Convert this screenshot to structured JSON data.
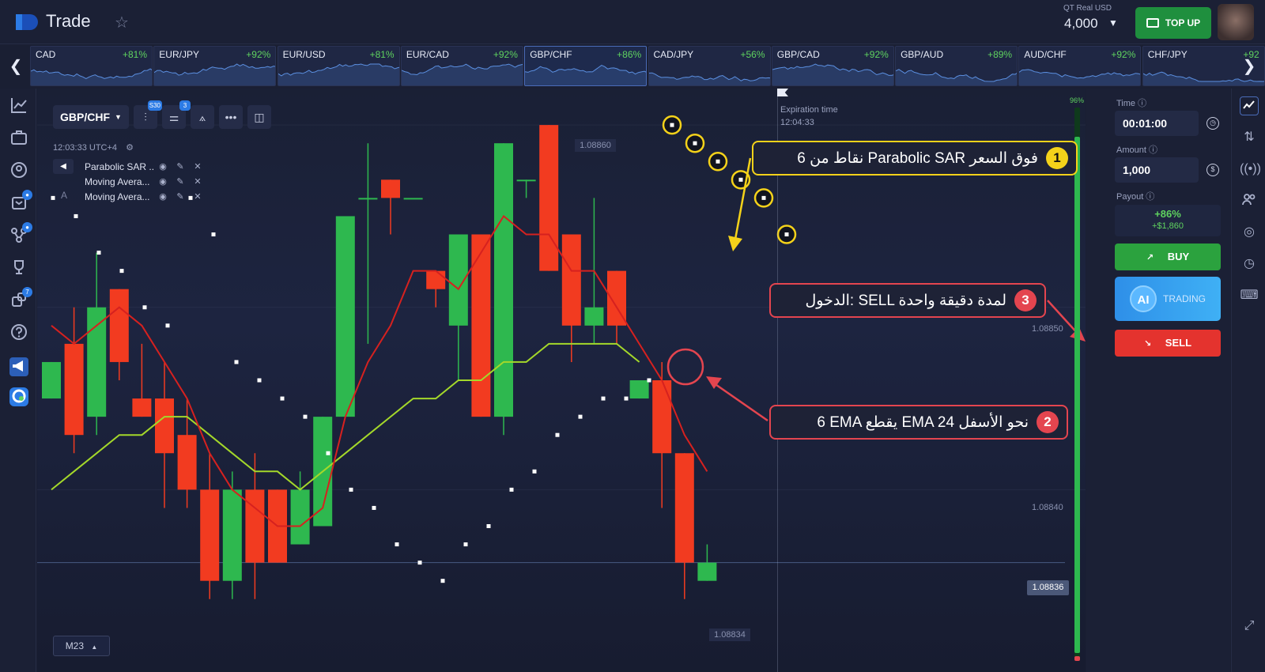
{
  "app": {
    "name": "Trade"
  },
  "account": {
    "label": "QT Real  USD",
    "balance": "4,000",
    "topup_label": "TOP UP"
  },
  "pairs": [
    {
      "name": "CAD",
      "payout": "+81%"
    },
    {
      "name": "EUR/JPY",
      "payout": "+92%"
    },
    {
      "name": "EUR/USD",
      "payout": "+81%"
    },
    {
      "name": "EUR/CAD",
      "payout": "+92%"
    },
    {
      "name": "GBP/CHF",
      "payout": "+86%"
    },
    {
      "name": "CAD/JPY",
      "payout": "+56%"
    },
    {
      "name": "GBP/CAD",
      "payout": "+92%"
    },
    {
      "name": "GBP/AUD",
      "payout": "+89%"
    },
    {
      "name": "AUD/CHF",
      "payout": "+92%"
    },
    {
      "name": "CHF/JPY",
      "payout": "+92"
    }
  ],
  "active_pair_index": 4,
  "chart": {
    "symbol": "GBP/CHF",
    "clock": "12:03:33 UTC+4",
    "tool_badges": [
      "S30",
      "3"
    ],
    "indicators": [
      "Parabolic SAR ...",
      "Moving Avera...",
      "Moving Avera..."
    ],
    "expiration_label": "Expiration time",
    "expiration_time": "12:04:33",
    "price_high": "1.08860",
    "price_low": "1.08834",
    "current_price": "1.08836",
    "price_levels": [
      "1.08850",
      "1.08840"
    ],
    "timeframe": "M23",
    "volume_pct": "96%",
    "volume_level": 0.96
  },
  "chart_data": {
    "type": "candlestick",
    "candles": [
      {
        "o": 1.08845,
        "h": 1.08847,
        "l": 1.08845,
        "c": 1.08847
      },
      {
        "o": 1.08848,
        "h": 1.0885,
        "l": 1.08842,
        "c": 1.08843
      },
      {
        "o": 1.08844,
        "h": 1.08853,
        "l": 1.08843,
        "c": 1.0885
      },
      {
        "o": 1.08851,
        "h": 1.08851,
        "l": 1.08846,
        "c": 1.08847
      },
      {
        "o": 1.08845,
        "h": 1.08848,
        "l": 1.08844,
        "c": 1.08844
      },
      {
        "o": 1.08845,
        "h": 1.08847,
        "l": 1.08839,
        "c": 1.08842
      },
      {
        "o": 1.08843,
        "h": 1.08845,
        "l": 1.08839,
        "c": 1.0884
      },
      {
        "o": 1.0884,
        "h": 1.08842,
        "l": 1.08834,
        "c": 1.08835
      },
      {
        "o": 1.08835,
        "h": 1.08841,
        "l": 1.08834,
        "c": 1.0884
      },
      {
        "o": 1.0884,
        "h": 1.08842,
        "l": 1.08834,
        "c": 1.08836
      },
      {
        "o": 1.0884,
        "h": 1.0884,
        "l": 1.08836,
        "c": 1.08836
      },
      {
        "o": 1.08837,
        "h": 1.08841,
        "l": 1.08837,
        "c": 1.0884
      },
      {
        "o": 1.08838,
        "h": 1.08844,
        "l": 1.08838,
        "c": 1.08844
      },
      {
        "o": 1.08844,
        "h": 1.08855,
        "l": 1.08844,
        "c": 1.08855
      },
      {
        "o": 1.08856,
        "h": 1.08859,
        "l": 1.08848,
        "c": 1.08856
      },
      {
        "o": 1.08857,
        "h": 1.08856,
        "l": 1.08854,
        "c": 1.08856
      },
      {
        "o": 1.08856,
        "h": 1.08856,
        "l": 1.08856,
        "c": 1.08856
      },
      {
        "o": 1.08852,
        "h": 1.08852,
        "l": 1.0885,
        "c": 1.08851
      },
      {
        "o": 1.08849,
        "h": 1.08854,
        "l": 1.08846,
        "c": 1.08854
      },
      {
        "o": 1.08854,
        "h": 1.08854,
        "l": 1.08844,
        "c": 1.08844
      },
      {
        "o": 1.08844,
        "h": 1.08859,
        "l": 1.08843,
        "c": 1.08859
      },
      {
        "o": 1.08857,
        "h": 1.08857,
        "l": 1.08856,
        "c": 1.08857
      },
      {
        "o": 1.0886,
        "h": 1.0886,
        "l": 1.08852,
        "c": 1.08852
      },
      {
        "o": 1.08854,
        "h": 1.08854,
        "l": 1.08847,
        "c": 1.08849
      },
      {
        "o": 1.08849,
        "h": 1.08856,
        "l": 1.08848,
        "c": 1.0885
      },
      {
        "o": 1.08852,
        "h": 1.08852,
        "l": 1.08848,
        "c": 1.08849
      },
      {
        "o": 1.08845,
        "h": 1.08846,
        "l": 1.08845,
        "c": 1.08846
      },
      {
        "o": 1.08846,
        "h": 1.08847,
        "l": 1.08839,
        "c": 1.08842
      },
      {
        "o": 1.08842,
        "h": 1.08842,
        "l": 1.08834,
        "c": 1.08836
      },
      {
        "o": 1.08835,
        "h": 1.08837,
        "l": 1.08835,
        "c": 1.08836
      }
    ],
    "ema6": [
      1.08849,
      1.08848,
      1.08849,
      1.0885,
      1.08849,
      1.08847,
      1.08845,
      1.08842,
      1.0884,
      1.08839,
      1.08838,
      1.08838,
      1.08839,
      1.08844,
      1.08847,
      1.08849,
      1.08852,
      1.08852,
      1.08851,
      1.08853,
      1.08855,
      1.08854,
      1.08854,
      1.08852,
      1.08852,
      1.0885,
      1.08848,
      1.08846,
      1.08843,
      1.08841
    ],
    "ema24": [
      1.0884,
      1.08841,
      1.08842,
      1.08843,
      1.08843,
      1.08844,
      1.08844,
      1.08843,
      1.08842,
      1.08841,
      1.08841,
      1.0884,
      1.08841,
      1.08842,
      1.08843,
      1.08844,
      1.08845,
      1.08845,
      1.08846,
      1.08846,
      1.08847,
      1.08847,
      1.08848,
      1.08848,
      1.08848,
      1.08848,
      1.08847
    ],
    "psar": [
      1.08856,
      1.08855,
      1.08853,
      1.08852,
      1.0885,
      1.08849,
      1.08856,
      1.08854,
      1.08847,
      1.08846,
      1.08845,
      1.08844,
      1.08842,
      1.0884,
      1.08839,
      1.08837,
      1.08836,
      1.08835,
      1.08837,
      1.08838,
      1.0884,
      1.08841,
      1.08843,
      1.08844,
      1.08845,
      1.08845,
      1.08846,
      1.0886,
      1.08859,
      1.08858,
      1.08857,
      1.08856,
      1.08854
    ],
    "sar_highlight_count": 6,
    "current_price": 1.08836
  },
  "callouts": [
    {
      "num": "1",
      "text": "6 نقاط من Parabolic SAR فوق السعر"
    },
    {
      "num": "2",
      "text": "6 EMA يقطع EMA 24 نحو الأسفل"
    },
    {
      "num": "3",
      "text": "الدخول: SELL لمدة دقيقة واحدة"
    }
  ],
  "trade": {
    "time_label": "Time",
    "time_value": "00:01:00",
    "amount_label": "Amount",
    "amount_value": "1,000",
    "payout_label": "Payout",
    "payout_pct": "+86%",
    "payout_amount": "+$1,860",
    "buy_label": "BUY",
    "ai_icon": "AI",
    "ai_label": "TRADING",
    "sell_label": "SELL"
  },
  "sidebar_badges": [
    "7"
  ],
  "colors": {
    "up": "#2eb84f",
    "down": "#f23b20",
    "ema6": "#d6211f",
    "ema24": "#a4d82a",
    "accent": "#2c7be5"
  }
}
